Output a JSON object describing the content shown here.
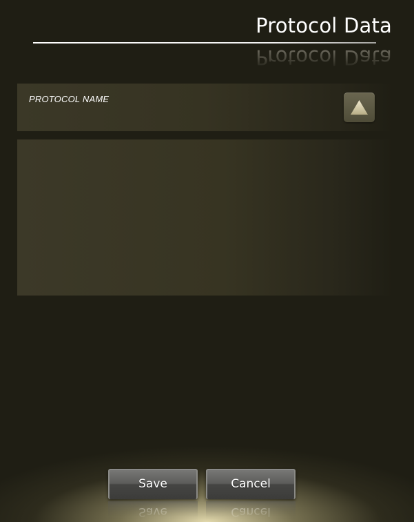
{
  "header": {
    "title": "Protocol Data"
  },
  "protocol_name": {
    "label": "PROTOCOL NAME",
    "up_icon": "up-triangle-icon"
  },
  "content": {},
  "actions": {
    "save_label": "Save",
    "cancel_label": "Cancel"
  },
  "colors": {
    "background": "#1f1e14",
    "panel": "#3b3827",
    "glow": "#ece2b4",
    "button": "#5c5c5a"
  }
}
